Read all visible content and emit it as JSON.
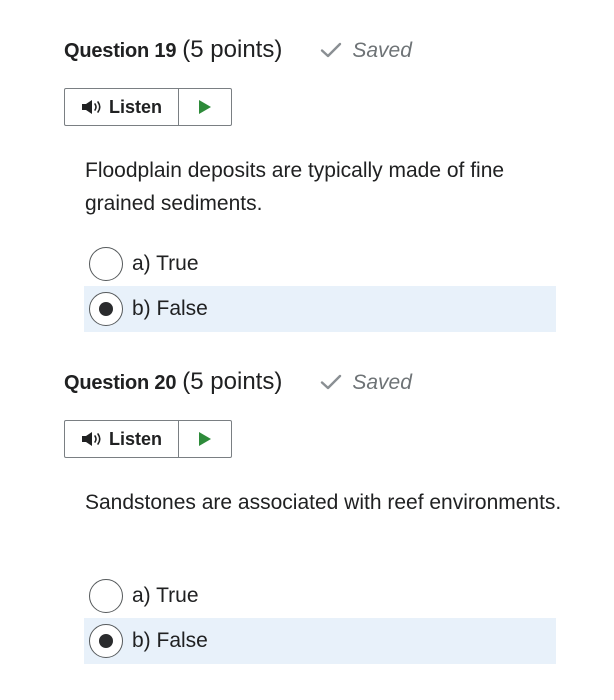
{
  "questions": [
    {
      "title": "Question 19",
      "points": "(5 points)",
      "status": "Saved",
      "listen_label": "Listen",
      "text": "Floodplain deposits are typically made of fine grained sediments.",
      "options": [
        {
          "label": "a) True",
          "selected": false
        },
        {
          "label": "b) False",
          "selected": true
        }
      ]
    },
    {
      "title": "Question 20",
      "points": "(5 points)",
      "status": "Saved",
      "listen_label": "Listen",
      "text": "Sandstones are associated with reef environments.",
      "options": [
        {
          "label": "a) True",
          "selected": false
        },
        {
          "label": "b) False",
          "selected": true
        }
      ]
    }
  ],
  "icons": {
    "saved": "check-icon",
    "listen": "speaker-icon",
    "play": "play-icon"
  },
  "colors": {
    "selected_bg": "#e8f1fa",
    "play_green": "#2e8b3a",
    "saved_gray": "#6e7376"
  }
}
